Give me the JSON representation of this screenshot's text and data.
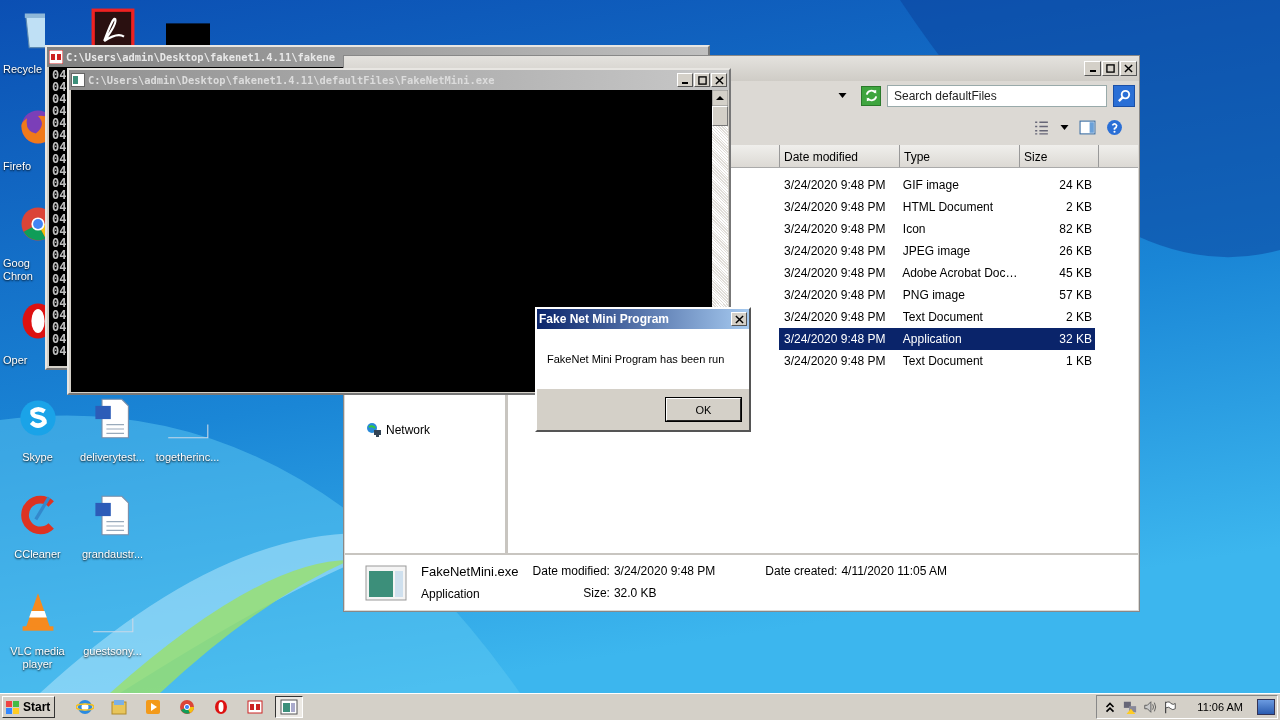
{
  "desktop": {
    "icons": [
      {
        "kind": "recycle",
        "label": "Recycle",
        "cut": true
      },
      {
        "kind": "firefox",
        "label": "Firefo",
        "cut": true
      },
      {
        "kind": "chrome",
        "label": "Goog\nChron",
        "cut": true
      },
      {
        "kind": "opera",
        "label": "Oper",
        "cut": true
      },
      {
        "kind": "skype",
        "label": "Skype",
        "cut": false
      },
      {
        "kind": "ccleaner",
        "label": "CCleaner",
        "cut": false
      },
      {
        "kind": "vlc",
        "label": "VLC media player",
        "cut": false
      },
      {
        "kind": "acrobat"
      },
      {
        "kind": "word",
        "label": "deliverytest...",
        "cut": false
      },
      {
        "kind": "word",
        "label": "grandaustr...",
        "cut": false
      },
      {
        "kind": "blank",
        "label": "guestsony...",
        "cut": false
      },
      {
        "kind": "black"
      },
      {
        "kind": "blank",
        "label": "togetherinc...",
        "cut": false
      }
    ]
  },
  "console_back": {
    "title": "C:\\Users\\admin\\Desktop\\fakenet1.4.11\\fakene",
    "lines": [
      "04",
      "04",
      "04",
      "04",
      "04",
      "04",
      "04",
      "04",
      "04",
      "04",
      "04",
      "04",
      "04",
      "04",
      "04",
      "04",
      "04",
      "04",
      "04",
      "04",
      "04",
      "04",
      "04",
      "04"
    ]
  },
  "explorer": {
    "search": {
      "placeholder": "Search defaultFiles"
    },
    "columns": [
      "Date modified",
      "Type",
      "Size"
    ],
    "rows": [
      {
        "date": "3/24/2020 9:48 PM",
        "type": "GIF image",
        "size": "24 KB",
        "selected": false
      },
      {
        "date": "3/24/2020 9:48 PM",
        "type": "HTML Document",
        "size": "2 KB",
        "selected": false
      },
      {
        "date": "3/24/2020 9:48 PM",
        "type": "Icon",
        "size": "82 KB",
        "selected": false
      },
      {
        "date": "3/24/2020 9:48 PM",
        "type": "JPEG image",
        "size": "26 KB",
        "selected": false
      },
      {
        "date": "3/24/2020 9:48 PM",
        "type": "Adobe Acrobat Doc…",
        "size": "45 KB",
        "selected": false
      },
      {
        "date": "3/24/2020 9:48 PM",
        "type": "PNG image",
        "size": "57 KB",
        "selected": false
      },
      {
        "date": "3/24/2020 9:48 PM",
        "type": "Text Document",
        "size": "2 KB",
        "selected": false
      },
      {
        "date": "3/24/2020 9:48 PM",
        "type": "Application",
        "size": "32 KB",
        "selected": true
      },
      {
        "date": "3/24/2020 9:48 PM",
        "type": "Text Document",
        "size": "1 KB",
        "selected": false
      }
    ],
    "nav": [
      {
        "label": "Network"
      }
    ],
    "details": {
      "name": "FakeNetMini.exe",
      "type": "Application",
      "groups": [
        [
          {
            "label": "Date modified:",
            "value": "3/24/2020 9:48 PM"
          },
          {
            "label": "Size:",
            "value": "32.0 KB"
          }
        ],
        [
          {
            "label": "Date created:",
            "value": "4/11/2020 11:05 AM"
          }
        ]
      ]
    }
  },
  "console_front": {
    "title": "C:\\Users\\admin\\Desktop\\fakenet1.4.11\\defaultFiles\\FakeNetMini.exe"
  },
  "dialog": {
    "title": "Fake Net Mini Program",
    "message": "FakeNet Mini Program has been run",
    "button": "OK"
  },
  "taskbar": {
    "start": "Start",
    "apps": [
      {
        "kind": "ie",
        "selected": false
      },
      {
        "kind": "folder",
        "selected": false
      },
      {
        "kind": "media",
        "selected": false
      },
      {
        "kind": "chrome",
        "selected": false
      },
      {
        "kind": "opera",
        "selected": false
      },
      {
        "kind": "fakenet",
        "selected": false
      },
      {
        "kind": "console",
        "selected": true
      }
    ],
    "clock": "11:06 AM"
  }
}
